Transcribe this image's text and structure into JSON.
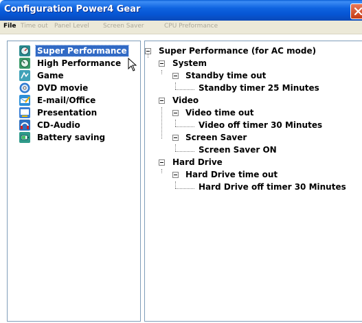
{
  "window": {
    "title": "Configuration Power4 Gear"
  },
  "menu": [
    {
      "label": "File",
      "enabled": true
    },
    {
      "label": "Time out",
      "enabled": false
    },
    {
      "label": "Panel Level",
      "enabled": false
    },
    {
      "label": "Screen Saver",
      "enabled": false
    },
    {
      "label": "CPU Preformance",
      "enabled": false
    }
  ],
  "modes": [
    {
      "label": "Super Performance",
      "icon": "super-performance-icon",
      "selected": true
    },
    {
      "label": "High Performance",
      "icon": "high-performance-icon"
    },
    {
      "label": "Game",
      "icon": "game-icon"
    },
    {
      "label": "DVD movie",
      "icon": "dvd-movie-icon"
    },
    {
      "label": "E-mail/Office",
      "icon": "email-office-icon"
    },
    {
      "label": "Presentation",
      "icon": "presentation-icon"
    },
    {
      "label": "CD-Audio",
      "icon": "cd-audio-icon"
    },
    {
      "label": "Battery saving",
      "icon": "battery-saving-icon"
    }
  ],
  "tree": {
    "root": "Super Performance (for AC mode)",
    "system": "System",
    "standby_group": "Standby time out",
    "standby_value": "Standby timer 25 Minutes",
    "video": "Video",
    "video_group": "Video time out",
    "video_value": "Video off timer 30 Minutes",
    "saver_group": "Screen Saver",
    "saver_value": "Screen Saver ON",
    "hdd": "Hard Drive",
    "hdd_group": "Hard Drive time out",
    "hdd_value": "Hard Drive off timer 30 Minutes"
  },
  "colors": {
    "selection": "#316ac5",
    "titlebar": "#0655d3"
  }
}
